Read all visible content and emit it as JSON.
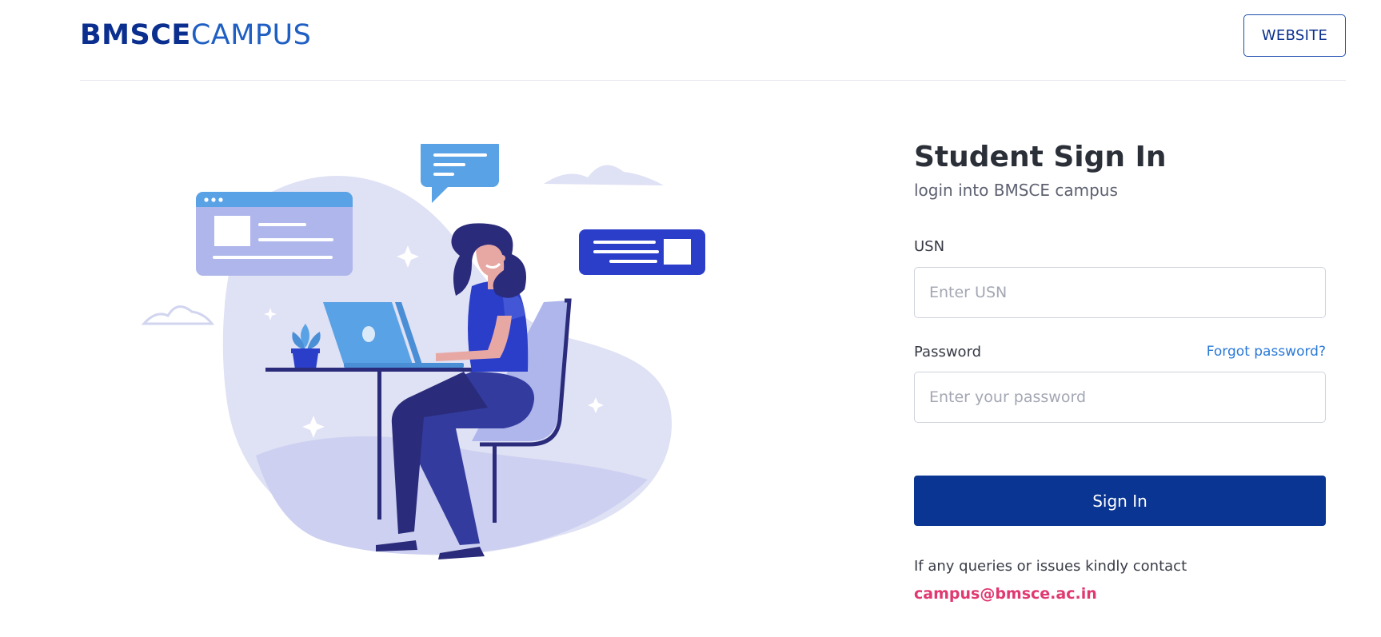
{
  "header": {
    "logo_bold": "BMSCE",
    "logo_light": "CAMPUS",
    "website_label": "WEBSITE"
  },
  "illustration": {
    "icon": "student-with-laptop-illustration",
    "colors": {
      "blob": "#dfe1f5",
      "blob_dark": "#cdd0f0",
      "card_light": "#aeb6eb",
      "card_dark": "#2b3ec9",
      "bubble": "#5aa2e6",
      "navy": "#2a2b7a"
    }
  },
  "form": {
    "title": "Student Sign In",
    "subtitle": "login into BMSCE campus",
    "usn_label": "USN",
    "usn_placeholder": "Enter USN",
    "usn_value": "",
    "password_label": "Password",
    "forgot_label": "Forgot password?",
    "password_placeholder": "Enter your password",
    "password_value": "",
    "signin_label": "Sign In",
    "contact_text": "If any queries or issues kindly contact",
    "contact_email": "campus@bmsce.ac.in"
  },
  "colors": {
    "brand": "#0a2f8f",
    "button": "#0a3592",
    "link": "#2a79d8",
    "email": "#e0386f"
  }
}
